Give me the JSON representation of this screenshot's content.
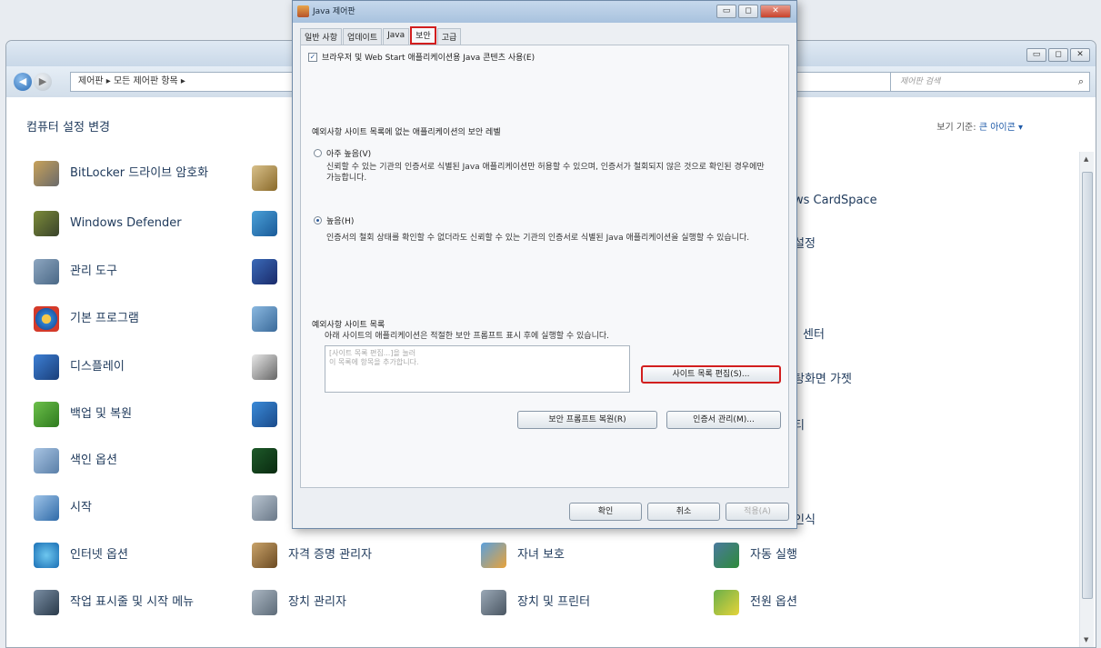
{
  "java_dialog": {
    "title": "Java 제어판",
    "tabs": [
      "일반 사항",
      "업데이트",
      "Java",
      "보안",
      "고급"
    ],
    "active_tab": "보안",
    "checkbox_label": "브라우저 및 Web Start 애플리케이션용 Java 콘텐츠 사용(E)",
    "checkbox_checked": true,
    "level_heading": "예외사항 사이트 목록에 없는 애플리케이션의 보안 레벨",
    "options": [
      {
        "label": "아주 높음(V)",
        "desc": "신뢰할 수 있는 기관의 인증서로 식별된 Java 애플리케이션만 허용할 수 있으며, 인증서가 철회되지 않은 것으로 확인된 경우에만 가능합니다.",
        "selected": false
      },
      {
        "label": "높음(H)",
        "desc": "인증서의 철회 상태를 확인할 수 없더라도 신뢰할 수 있는 기관의 인증서로 식별된 Java 애플리케이션을 실행할 수 있습니다.",
        "selected": true
      }
    ],
    "exception_heading": "예외사항 사이트 목록",
    "exception_desc": "아래 사이트의 애플리케이션은 적절한 보안 프롬프트 표시 후에 실행할 수 있습니다.",
    "list_placeholder_1": "[사이트 목록 편집...]을 눌러",
    "list_placeholder_2": "이 목록에 항목을 추가합니다.",
    "edit_sites_button": "사이트 목록 편집(S)...",
    "restore_prompts_button": "보안 프롬프트 복원(R)",
    "manage_certs_button": "인증서 관리(M)...",
    "ok_button": "확인",
    "cancel_button": "취소",
    "apply_button": "적용(A)"
  },
  "control_panel": {
    "breadcrumb": "제어판 ▸ 모든 제어판 항목 ▸",
    "search_placeholder": "제어판 검색",
    "heading": "컴퓨터 설정 변경",
    "view_by_label": "보기 기준:",
    "view_by_value": "큰 아이콘 ▾",
    "col1": [
      "BitLocker 드라이브 암호화",
      "Windows Defender",
      "관리 도구",
      "기본 프로그램",
      "디스플레이",
      "백업 및 복원",
      "색인 옵션",
      "시작",
      "인터넷 옵션",
      "작업 표시줄 및 시작 메뉴"
    ],
    "col2": [
      "자격 증명 관리자",
      "장치 관리자"
    ],
    "col3": [
      "자녀 보호",
      "장치 및 프린터"
    ],
    "col4": [
      "ws CardSpace",
      "설정",
      "센터",
      "탕화면 가젯",
      "티",
      "인식",
      "자동 실행",
      "전원 옵션"
    ]
  }
}
